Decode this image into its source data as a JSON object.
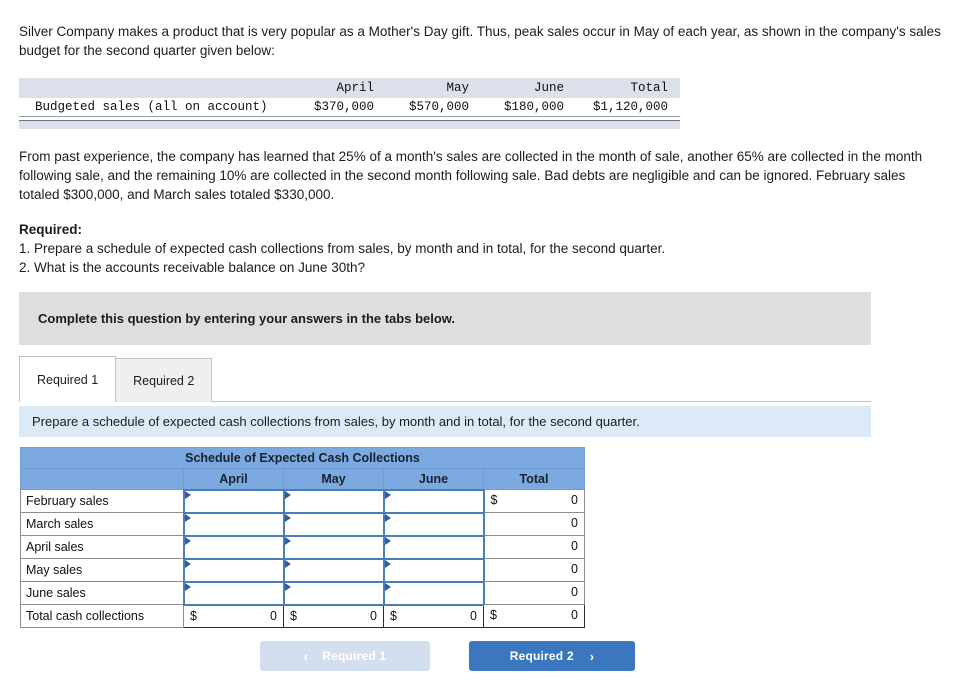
{
  "intro": {
    "paragraph": "Silver Company makes a product that is very popular as a Mother's Day gift. Thus, peak sales occur in May of each year, as shown in the company's sales budget for the second quarter given below:"
  },
  "budget_table": {
    "columns": [
      "",
      "April",
      "May",
      "June",
      "Total"
    ],
    "row_label": "Budgeted sales (all on account)",
    "values": [
      "$370,000",
      "$570,000",
      "$180,000",
      "$1,120,000"
    ]
  },
  "assumptions": {
    "paragraph": "From past experience, the company has learned that 25% of a month's sales are collected in the month of sale, another 65% are collected in the month following sale, and the remaining 10% are collected in the second month following sale. Bad debts are negligible and can be ignored. February sales totaled $300,000, and March sales totaled $330,000."
  },
  "required": {
    "title": "Required:",
    "item1": "1. Prepare a schedule of expected cash collections from sales, by month and in total, for the second quarter.",
    "item2": "2. What is the accounts receivable balance on June 30th?"
  },
  "banner": {
    "text": "Complete this question by entering your answers in the tabs below."
  },
  "tabs": [
    {
      "label": "Required 1",
      "active": true
    },
    {
      "label": "Required 2",
      "active": false
    }
  ],
  "instruction": {
    "text": "Prepare a schedule of expected cash collections from sales, by month and in total, for the second quarter."
  },
  "schedule": {
    "title": "Schedule of Expected Cash Collections",
    "columns": [
      "",
      "April",
      "May",
      "June",
      "Total"
    ],
    "rows": [
      {
        "label": "February sales",
        "april": "",
        "may": "",
        "june": "",
        "total_dollar": "$",
        "total": "0"
      },
      {
        "label": "March sales",
        "april": "",
        "may": "",
        "june": "",
        "total_dollar": "",
        "total": "0"
      },
      {
        "label": "April sales",
        "april": "",
        "may": "",
        "june": "",
        "total_dollar": "",
        "total": "0"
      },
      {
        "label": "May sales",
        "april": "",
        "may": "",
        "june": "",
        "total_dollar": "",
        "total": "0"
      },
      {
        "label": "June sales",
        "april": "",
        "may": "",
        "june": "",
        "total_dollar": "",
        "total": "0"
      }
    ],
    "total_row": {
      "label": "Total cash collections",
      "april_dollar": "$",
      "april": "0",
      "may_dollar": "$",
      "may": "0",
      "june_dollar": "$",
      "june": "0",
      "total_dollar": "$",
      "total": "0"
    }
  },
  "footer": {
    "prev_label": "Required 1",
    "prev_chevron": "‹",
    "next_label": "Required 2",
    "next_chevron": "›"
  },
  "colors": {
    "table_header_blue": "#7caae0",
    "input_border_blue": "#4a7ebb",
    "instruction_blue": "#dceaf7",
    "banner_gray": "#dedede",
    "button_blue": "#3b77bf",
    "button_disabled_blue": "#d3deee",
    "budget_header_gray": "#dbe0ea"
  }
}
